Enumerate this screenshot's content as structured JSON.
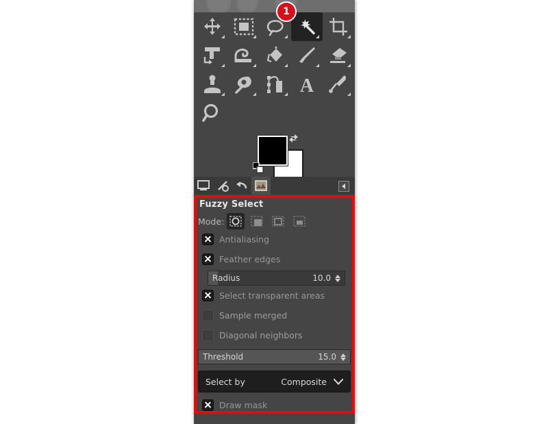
{
  "app": {
    "panel_name": "gimp-toolbox-dock"
  },
  "badge": {
    "number": "1"
  },
  "toolbox": {
    "rows": [
      [
        {
          "name": "move-tool",
          "title": "Move"
        },
        {
          "name": "rectangle-select-tool",
          "title": "Rectangle Select"
        },
        {
          "name": "free-select-tool",
          "title": "Free Select"
        },
        {
          "name": "fuzzy-select-tool",
          "title": "Fuzzy Select",
          "active": true
        },
        {
          "name": "crop-tool",
          "title": "Crop"
        }
      ],
      [
        {
          "name": "unified-transform-tool",
          "title": "Unified Transform"
        },
        {
          "name": "warp-transform-tool",
          "title": "Warp Transform"
        },
        {
          "name": "bucket-fill-tool",
          "title": "Bucket Fill"
        },
        {
          "name": "paintbrush-tool",
          "title": "Paintbrush"
        },
        {
          "name": "eraser-tool",
          "title": "Eraser"
        }
      ],
      [
        {
          "name": "clone-tool",
          "title": "Clone"
        },
        {
          "name": "smudge-tool",
          "title": "Smudge"
        },
        {
          "name": "paths-tool",
          "title": "Paths"
        },
        {
          "name": "text-tool",
          "title": "Text"
        },
        {
          "name": "color-picker-tool",
          "title": "Color Picker"
        }
      ],
      [
        {
          "name": "zoom-tool",
          "title": "Zoom"
        }
      ]
    ]
  },
  "colors": {
    "foreground": "#000000",
    "background": "#ffffff"
  },
  "dialog_tabs": [
    {
      "name": "tab-device-status",
      "selected": false
    },
    {
      "name": "tab-images",
      "selected": false
    },
    {
      "name": "tab-undo-history",
      "selected": false
    },
    {
      "name": "tab-tool-options",
      "selected": true
    }
  ],
  "tool_options": {
    "title": "Fuzzy Select",
    "mode": {
      "label": "Mode:",
      "buttons": [
        {
          "name": "mode-replace",
          "active": true
        },
        {
          "name": "mode-add",
          "active": false
        },
        {
          "name": "mode-subtract",
          "active": false
        },
        {
          "name": "mode-intersect",
          "active": false
        }
      ]
    },
    "checkboxes": [
      {
        "name": "antialiasing",
        "label": "Antialiasing",
        "checked": true
      },
      {
        "name": "feather-edges",
        "label": "Feather edges",
        "checked": true
      },
      {
        "name": "select-transparent-areas",
        "label": "Select transparent areas",
        "checked": true
      },
      {
        "name": "sample-merged",
        "label": "Sample merged",
        "checked": false
      },
      {
        "name": "diagonal-neighbors",
        "label": "Diagonal neighbors",
        "checked": false
      },
      {
        "name": "draw-mask",
        "label": "Draw mask",
        "checked": true
      }
    ],
    "radius": {
      "label": "Radius",
      "value": "10.0",
      "fill_percent": 7
    },
    "threshold": {
      "label": "Threshold",
      "value": "15.0",
      "fill_percent": 100
    },
    "select_by": {
      "label": "Select by",
      "value": "Composite"
    }
  },
  "highlight": {
    "color": "#fe0000"
  }
}
